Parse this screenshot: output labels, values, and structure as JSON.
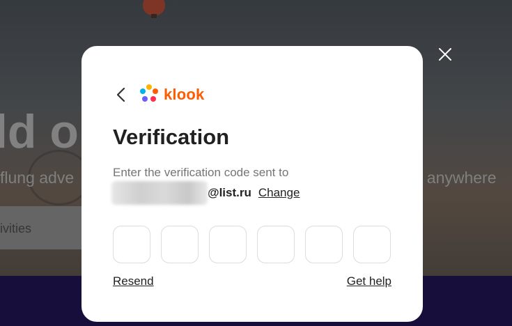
{
  "background": {
    "hero_title": "ld o",
    "hero_sub_left": "flung adve",
    "hero_sub_right": ", anywhere",
    "search_text": "ivities"
  },
  "modal": {
    "logo_text": "klook",
    "title": "Verification",
    "description": "Enter the verification code sent to",
    "email_domain": "@list.ru",
    "change_label": "Change",
    "code_boxes": [
      "",
      "",
      "",
      "",
      "",
      ""
    ],
    "resend_label": "Resend",
    "help_label": "Get help"
  },
  "colors": {
    "brand": "#ff5b00",
    "text": "#212121",
    "muted": "#757575",
    "border": "#dcdcdc"
  },
  "icons": {
    "back": "chevron-left-icon",
    "close": "close-icon",
    "logo": "klook-logo-icon"
  }
}
